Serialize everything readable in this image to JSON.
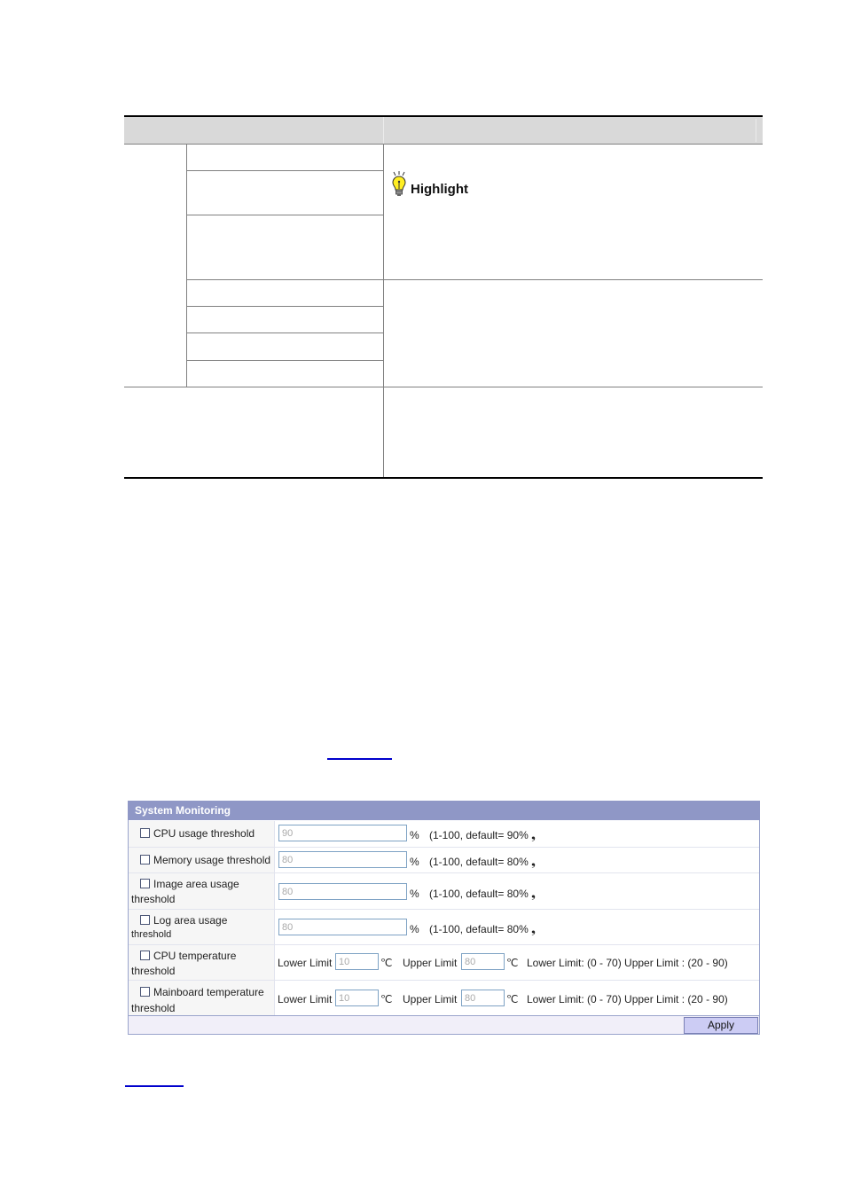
{
  "document_table": {
    "callout": {
      "icon": "lightbulb-icon",
      "label": "Highlight"
    }
  },
  "system_monitoring": {
    "title": "System Monitoring",
    "rows": [
      {
        "label_line1": "CPU usage threshold",
        "label_line2": "",
        "checked": false,
        "value": "90",
        "unit": "%",
        "hint": "(1-100, default= 90% ❟"
      },
      {
        "label_line1": "Memory usage threshold",
        "label_line2": "",
        "checked": false,
        "value": "80",
        "unit": "%",
        "hint": "(1-100, default= 80% ❟"
      },
      {
        "label_line1": "Image area usage",
        "label_line2": "threshold",
        "checked": false,
        "value": "80",
        "unit": "%",
        "hint": "(1-100, default= 80% ❟"
      },
      {
        "label_line1": "Log area usage",
        "label_line2": "threshold",
        "checked": false,
        "value": "80",
        "unit": "%",
        "hint": "(1-100, default= 80% ❟"
      }
    ],
    "temp_rows": [
      {
        "label_line1": "CPU temperature",
        "label_line2": "threshold",
        "checked": false,
        "lower_label": "Lower Limit",
        "lower_value": "10",
        "upper_label": "Upper Limit",
        "upper_value": "80",
        "unit": "℃",
        "hint": "Lower Limit: (0 - 70) Upper Limit : (20 - 90)"
      },
      {
        "label_line1": "Mainboard temperature",
        "label_line2": "threshold",
        "checked": false,
        "lower_label": "Lower Limit",
        "lower_value": "10",
        "upper_label": "Upper Limit",
        "upper_value": "80",
        "unit": "℃",
        "hint": "Lower Limit: (0 - 70) Upper Limit : (20 - 90)"
      }
    ],
    "apply_label": "Apply"
  }
}
